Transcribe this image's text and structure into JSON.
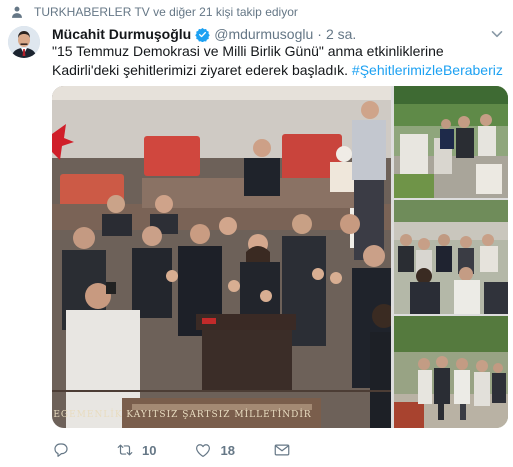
{
  "context": {
    "text": "TURKHABERLER TV ve diğer 21 kişi takip ediyor",
    "icon": "person-follow-icon"
  },
  "author": {
    "name": "Mücahit Durmuşoğlu",
    "handle": "@mdurmusoglu",
    "separator": "·",
    "time": "2 sa.",
    "verified": true,
    "avatar_icon": "avatar-photo"
  },
  "tweet": {
    "text_part1": "\"15 Temmuz Demokrasi ve Milli Birlik Günü\" anma etkinliklerine Kadirli'deki şehitlerimizi ziyaret ederek başladık. ",
    "hashtag": "#ŞehitlerimizleBeraberiz"
  },
  "media": {
    "banner_text": "EGEMENLİK KAYITSIZ ŞARTSIZ MİLLETİNDİR",
    "count": 4
  },
  "actions": {
    "reply_count": "",
    "retweet_count": "10",
    "like_count": "18",
    "dm_count": ""
  },
  "colors": {
    "link": "#1da1f2",
    "muted": "#657786",
    "text": "#14171a"
  }
}
